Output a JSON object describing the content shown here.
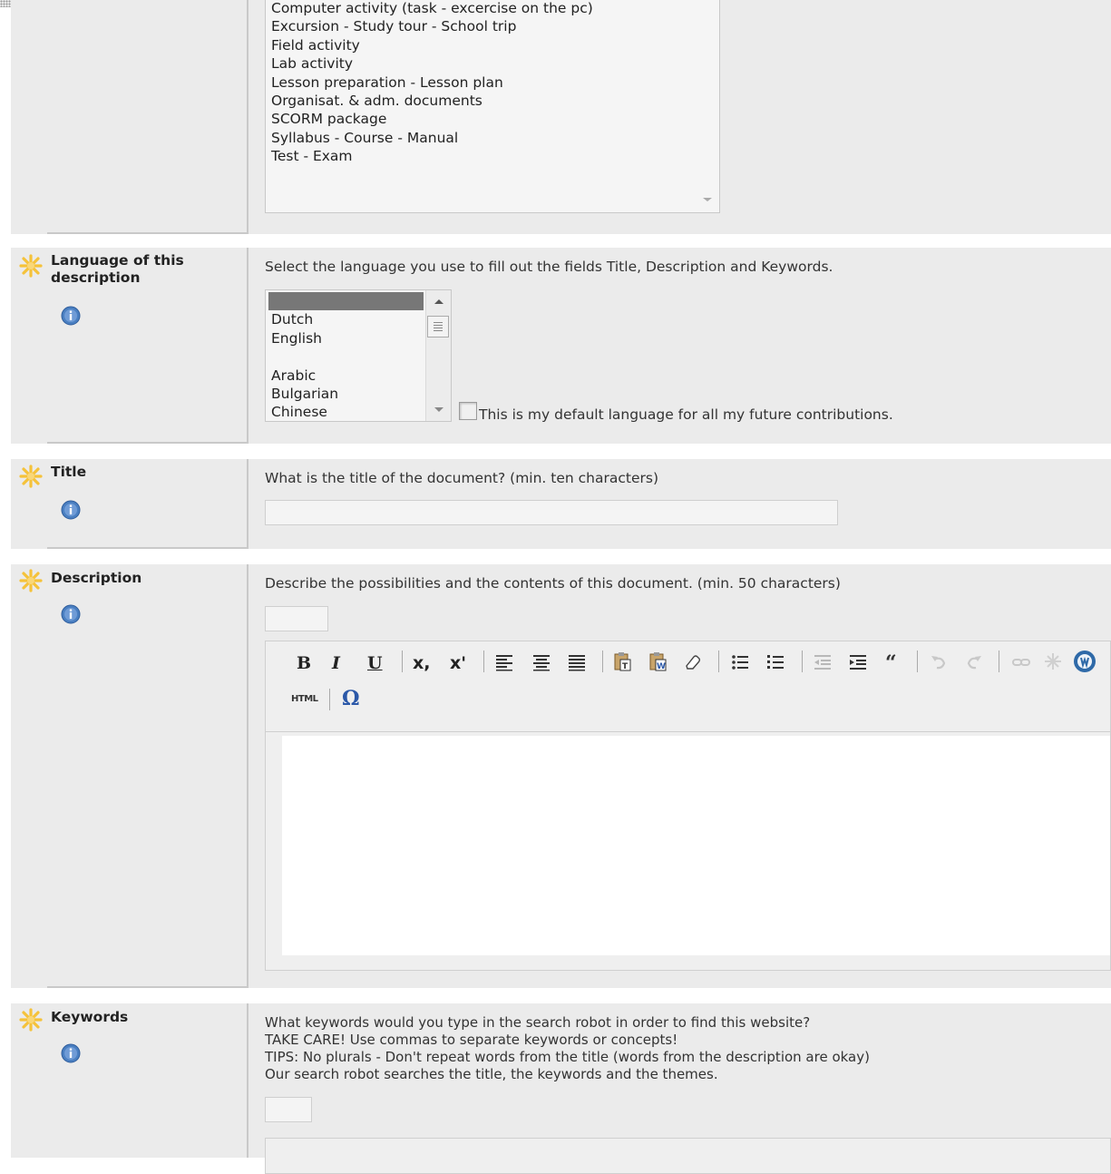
{
  "resource_type": {
    "options": [
      "Computer activity (task - excercise on the pc)",
      "Excursion - Study tour - School trip",
      "Field activity",
      "Lab activity",
      "Lesson preparation - Lesson plan",
      "Organisat. & adm. documents",
      "SCORM package",
      "Syllabus - Course - Manual",
      "Test - Exam"
    ]
  },
  "language": {
    "label": "Language of this description",
    "prompt": "Select the language you use to fill out the fields Title, Description and Keywords.",
    "options": [
      "",
      "Dutch",
      "English",
      "",
      "Arabic",
      "Bulgarian",
      "Chinese"
    ],
    "default_checkbox_label": "This is my default language for all my future contributions."
  },
  "title": {
    "label": "Title",
    "prompt": "What is the title of the document? (min. ten characters)"
  },
  "description": {
    "label": "Description",
    "prompt": "Describe the possibilities and the contents of this document. (min. 50 characters)",
    "toolbar": {
      "bold": "B",
      "italic": "I",
      "underline": "U",
      "subscript": "x,",
      "superscript": "x'",
      "html": "HTML",
      "special_char": "Ω"
    }
  },
  "keywords": {
    "label": "Keywords",
    "prompt_lines": [
      "What keywords would you type in the search robot in order to find this website?",
      "TAKE CARE! Use commas to separate keywords or concepts!",
      "TIPS: No plurals - Don't repeat words from the title (words from the description are okay)",
      "Our search robot searches the title, the keywords and the themes."
    ]
  },
  "colors": {
    "section_bg": "#ebebeb",
    "required_star": "#f5c23a",
    "info_icon": "#4a7fc1"
  }
}
